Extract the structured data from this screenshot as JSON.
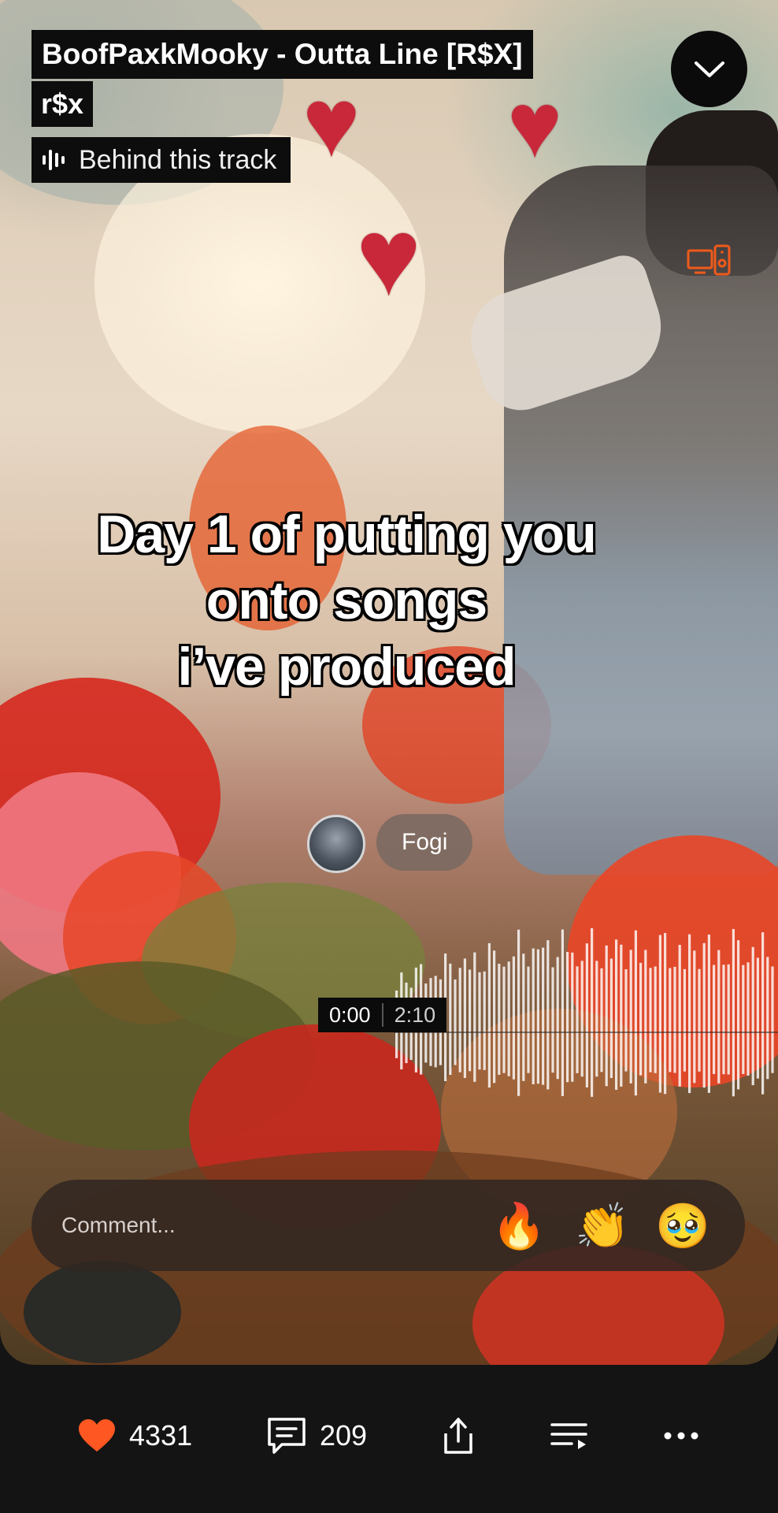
{
  "track": {
    "title": "BoofPaxkMooky - Outta Line [R$X]",
    "artist": "r$x",
    "behind_label": "Behind this track"
  },
  "caption": {
    "lines": [
      "Day 1 of putting you",
      "onto songs",
      "i’ve produced"
    ]
  },
  "comment": {
    "user": "Fogi"
  },
  "player": {
    "current_time": "0:00",
    "duration": "2:10",
    "progress": 0
  },
  "comment_bar": {
    "placeholder": "Comment...",
    "reactions": [
      "🔥",
      "👏",
      "🥹"
    ]
  },
  "actions": {
    "likes": "4331",
    "comments": "209"
  },
  "colors": {
    "like": "#ff5722",
    "cast_icon": "#f05a1a",
    "accent": "#ff5500"
  },
  "icons": [
    "chevron-down-icon",
    "cast-icon",
    "waveform-icon",
    "heart-icon",
    "comment-icon",
    "share-icon",
    "queue-icon",
    "more-icon"
  ]
}
